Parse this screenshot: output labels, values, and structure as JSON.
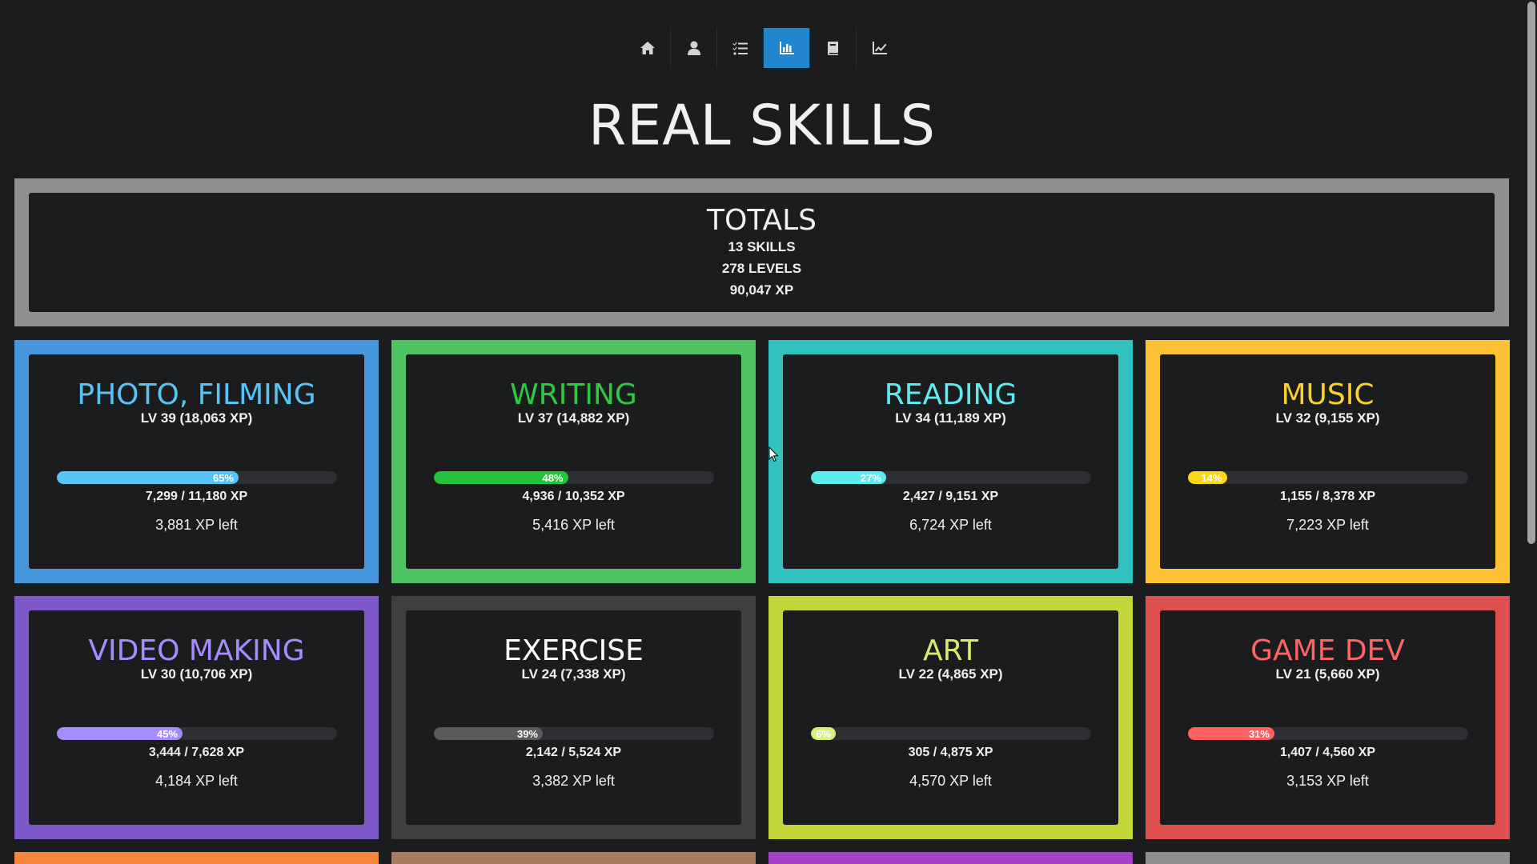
{
  "nav": {
    "items": [
      {
        "icon": "home-icon",
        "active": false
      },
      {
        "icon": "user-icon",
        "active": false
      },
      {
        "icon": "tasks-icon",
        "active": false
      },
      {
        "icon": "bar-chart-icon",
        "active": true
      },
      {
        "icon": "book-icon",
        "active": false
      },
      {
        "icon": "line-chart-icon",
        "active": false
      }
    ],
    "active_color": "#2185d0"
  },
  "title": "REAL SKILLS",
  "totals": {
    "heading": "TOTALS",
    "skills": "13 SKILLS",
    "levels": "278 LEVELS",
    "xp": "90,047 XP",
    "border_color": "#8f8f8f"
  },
  "skills": [
    {
      "name": "PHOTO, FILMING",
      "level": "LV 39 (18,063 XP)",
      "percent": 65,
      "percent_label": "65%",
      "progress": "7,299 / 11,180 XP",
      "left": "3,881 XP left",
      "border": "#4596dc",
      "name_color": "#59c3f5",
      "bar_color": "#59c3f5"
    },
    {
      "name": "WRITING",
      "level": "LV 37 (14,882 XP)",
      "percent": 48,
      "percent_label": "48%",
      "progress": "4,936 / 10,352 XP",
      "left": "5,416 XP left",
      "border": "#4fc463",
      "name_color": "#2cc941",
      "bar_color": "#23c43b"
    },
    {
      "name": "READING",
      "level": "LV 34 (11,189 XP)",
      "percent": 27,
      "percent_label": "27%",
      "progress": "2,427 / 9,151 XP",
      "left": "6,724 XP left",
      "border": "#32c2c0",
      "name_color": "#5feaf0",
      "bar_color": "#5feaf0"
    },
    {
      "name": "MUSIC",
      "level": "LV 32 (9,155 XP)",
      "percent": 14,
      "percent_label": "14%",
      "progress": "1,155 / 8,378 XP",
      "left": "7,223 XP left",
      "border": "#fbc334",
      "name_color": "#fbd22b",
      "bar_color": "#fbd61b"
    },
    {
      "name": "VIDEO MAKING",
      "level": "LV 30 (10,706 XP)",
      "percent": 45,
      "percent_label": "45%",
      "progress": "3,444 / 7,628 XP",
      "left": "4,184 XP left",
      "border": "#7e57c8",
      "name_color": "#a68cff",
      "bar_color": "#a68cff"
    },
    {
      "name": "EXERCISE",
      "level": "LV 24 (7,338 XP)",
      "percent": 39,
      "percent_label": "39%",
      "progress": "2,142 / 5,524 XP",
      "left": "3,382 XP left",
      "border": "#3e3f41",
      "name_color": "#ffffff",
      "bar_color": "#5a5a5a"
    },
    {
      "name": "ART",
      "level": "LV 22 (4,865 XP)",
      "percent": 6,
      "percent_label": "6%",
      "progress": "305 / 4,875 XP",
      "left": "4,570 XP left",
      "border": "#c2d63a",
      "name_color": "#d8ec6a",
      "bar_color": "#d9f07e"
    },
    {
      "name": "GAME DEV",
      "level": "LV 21 (5,660 XP)",
      "percent": 31,
      "percent_label": "31%",
      "progress": "1,407 / 4,560 XP",
      "left": "3,153 XP left",
      "border": "#de4f4f",
      "name_color": "#ff6464",
      "bar_color": "#ff6060"
    }
  ],
  "next_row_colors": [
    "#f6873a",
    "#a97a5c",
    "#a540c8",
    "#8f8f8f"
  ]
}
